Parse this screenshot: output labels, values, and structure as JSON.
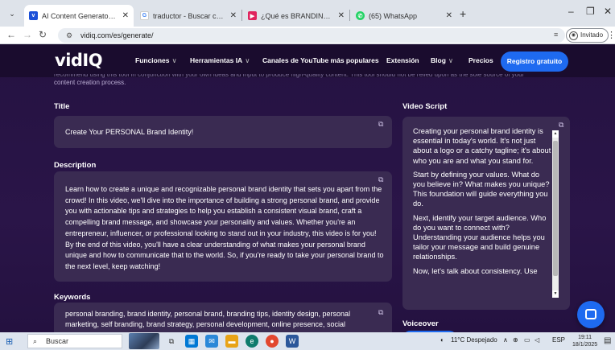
{
  "browser": {
    "tabs": [
      {
        "title": "AI Content Generator for YouT...",
        "favicon": "vidiq-icon",
        "color": "#1a4fd8",
        "active": true
      },
      {
        "title": "traductor - Buscar con Google",
        "favicon": "google-icon",
        "color": "#4285f4",
        "active": false
      },
      {
        "title": "¿Qué es BRANDING? | Definició",
        "favicon": "youtube-icon",
        "color": "#e0245e",
        "active": false
      },
      {
        "title": "(65) WhatsApp",
        "favicon": "whatsapp-icon",
        "color": "#25d366",
        "active": false
      }
    ],
    "address": "vidiq.com/es/generate/",
    "profile_label": "Invitado"
  },
  "site": {
    "logo": {
      "part1": "vid",
      "part2": "IQ"
    },
    "nav": [
      {
        "label": "Funciones",
        "dropdown": true
      },
      {
        "label": "Herramientas IA",
        "dropdown": true
      },
      {
        "label": "Canales de YouTube más populares",
        "dropdown": false
      },
      {
        "label": "Extensión",
        "dropdown": false
      },
      {
        "label": "Blog",
        "dropdown": true
      },
      {
        "label": "Precios",
        "dropdown": false
      }
    ],
    "cta": "Registro gratuito"
  },
  "intro": {
    "cut_line": "recommend using this tool in conjunction with your own ideas and input to produce high-quality content. This tool should not be relied upon as the sole source of your",
    "line2": "content creation process."
  },
  "title_section": {
    "label": "Title",
    "value": "Create Your PERSONAL Brand Identity!"
  },
  "description_section": {
    "label": "Description",
    "value": "Learn how to create a unique and recognizable personal brand identity that sets you apart from the crowd! In this video, we'll dive into the importance of building a strong personal brand, and provide you with actionable tips and strategies to help you establish a consistent visual brand, craft a compelling brand message, and showcase your personality and values. Whether you're an entrepreneur, influencer, or professional looking to stand out in your industry, this video is for you! By the end of this video, you'll have a clear understanding of what makes your personal brand unique and how to communicate that to the world. So, if you're ready to take your personal brand to the next level, keep watching!"
  },
  "keywords_section": {
    "label": "Keywords",
    "value": "personal branding, brand identity, personal brand, branding tips, identity design, personal marketing, self branding, brand strategy, personal development, online presence, social"
  },
  "script_section": {
    "label": "Video Script",
    "paragraphs": [
      "Creating your personal brand identity is essential in today's world. It's not just about a logo or a catchy tagline; it's about who you are and what you stand for.",
      "Start by defining your values. What do you believe in? What makes you unique? This foundation will guide everything you do.",
      "Next, identify your target audience. Who do you want to connect with? Understanding your audience helps you tailor your message and build genuine relationships.",
      "Now, let's talk about consistency. Use"
    ]
  },
  "voiceover_section": {
    "label": "Voiceover"
  },
  "taskbar": {
    "search_placeholder": "Buscar",
    "weather": "11°C  Despejado",
    "lang": "ESP",
    "time": "19:11",
    "date": "18/1/2025"
  },
  "colors": {
    "accent": "#1e6af0",
    "page_bg": "#251242",
    "card_bg": "#3a2b52"
  }
}
